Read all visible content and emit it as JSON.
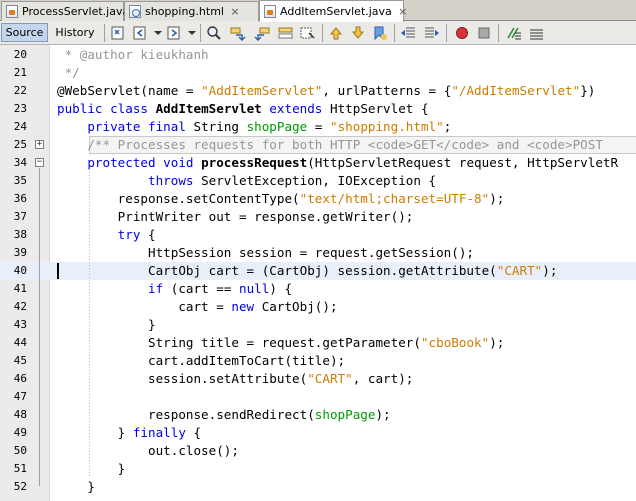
{
  "tabs": [
    {
      "label": "ProcessServlet.java",
      "icon": "java-file-icon",
      "active": false
    },
    {
      "label": "shopping.html",
      "icon": "html-file-icon",
      "active": false
    },
    {
      "label": "AddItemServlet.java",
      "icon": "java-file-icon",
      "active": true
    }
  ],
  "toolbar": {
    "source_label": "Source",
    "history_label": "History"
  },
  "editor": {
    "current_line": "40",
    "lines": [
      {
        "num": "20",
        "tokens": [
          {
            "t": " * @author kieukhanh",
            "c": "cm"
          }
        ]
      },
      {
        "num": "21",
        "tokens": [
          {
            "t": " */",
            "c": "cm"
          }
        ]
      },
      {
        "num": "22",
        "tokens": [
          {
            "t": "@WebServlet",
            "c": "ann"
          },
          {
            "t": "(name = ",
            "c": ""
          },
          {
            "t": "\"AddItemServlet\"",
            "c": "str"
          },
          {
            "t": ", urlPatterns = {",
            "c": ""
          },
          {
            "t": "\"/AddItemServlet\"",
            "c": "str"
          },
          {
            "t": "})",
            "c": ""
          }
        ]
      },
      {
        "num": "23",
        "tokens": [
          {
            "t": "public class ",
            "c": "kw"
          },
          {
            "t": "AddItemServlet",
            "c": "b"
          },
          {
            "t": " extends ",
            "c": "kw"
          },
          {
            "t": "HttpServlet {",
            "c": ""
          }
        ]
      },
      {
        "num": "24",
        "tokens": [
          {
            "t": "    private final ",
            "c": "kw"
          },
          {
            "t": "String ",
            "c": ""
          },
          {
            "t": "shopPage",
            "c": "fld"
          },
          {
            "t": " = ",
            "c": ""
          },
          {
            "t": "\"shopping.html\"",
            "c": "str"
          },
          {
            "t": ";",
            "c": ""
          }
        ]
      },
      {
        "num": "25",
        "tokens": [
          {
            "t": "    /** Processes requests for both HTTP <code>GET</code> and <code>POST",
            "c": "cm"
          }
        ]
      },
      {
        "num": "34",
        "tokens": [
          {
            "t": "    protected void ",
            "c": "kw"
          },
          {
            "t": "processRequest",
            "c": "b"
          },
          {
            "t": "(HttpServletRequest request, HttpServletR",
            "c": ""
          }
        ]
      },
      {
        "num": "35",
        "tokens": [
          {
            "t": "            throws ",
            "c": "kw"
          },
          {
            "t": "ServletException, IOException {",
            "c": ""
          }
        ]
      },
      {
        "num": "36",
        "tokens": [
          {
            "t": "        response.setContentType(",
            "c": ""
          },
          {
            "t": "\"text/html;charset=UTF-8\"",
            "c": "str"
          },
          {
            "t": ");",
            "c": ""
          }
        ]
      },
      {
        "num": "37",
        "tokens": [
          {
            "t": "        PrintWriter out = response.getWriter();",
            "c": ""
          }
        ]
      },
      {
        "num": "38",
        "tokens": [
          {
            "t": "        try",
            "c": "kw"
          },
          {
            "t": " {",
            "c": ""
          }
        ]
      },
      {
        "num": "39",
        "tokens": [
          {
            "t": "            HttpSession session = request.getSession();",
            "c": ""
          }
        ]
      },
      {
        "num": "40",
        "tokens": [
          {
            "t": "            CartObj cart = (CartObj) session.getAttribute(",
            "c": ""
          },
          {
            "t": "\"CART\"",
            "c": "str"
          },
          {
            "t": ");",
            "c": ""
          }
        ]
      },
      {
        "num": "41",
        "tokens": [
          {
            "t": "            if",
            "c": "kw"
          },
          {
            "t": " (cart == ",
            "c": ""
          },
          {
            "t": "null",
            "c": "kw"
          },
          {
            "t": ") {",
            "c": ""
          }
        ]
      },
      {
        "num": "42",
        "tokens": [
          {
            "t": "                cart = ",
            "c": ""
          },
          {
            "t": "new",
            "c": "kw"
          },
          {
            "t": " CartObj();",
            "c": ""
          }
        ]
      },
      {
        "num": "43",
        "tokens": [
          {
            "t": "            }",
            "c": ""
          }
        ]
      },
      {
        "num": "44",
        "tokens": [
          {
            "t": "            String title = request.getParameter(",
            "c": ""
          },
          {
            "t": "\"cboBook\"",
            "c": "str"
          },
          {
            "t": ");",
            "c": ""
          }
        ]
      },
      {
        "num": "45",
        "tokens": [
          {
            "t": "            cart.addItemToCart(title);",
            "c": ""
          }
        ]
      },
      {
        "num": "46",
        "tokens": [
          {
            "t": "            session.setAttribute(",
            "c": ""
          },
          {
            "t": "\"CART\"",
            "c": "str"
          },
          {
            "t": ", cart);",
            "c": ""
          }
        ]
      },
      {
        "num": "47",
        "tokens": []
      },
      {
        "num": "48",
        "tokens": [
          {
            "t": "            response.sendRedirect(",
            "c": ""
          },
          {
            "t": "shopPage",
            "c": "fld"
          },
          {
            "t": ");",
            "c": ""
          }
        ]
      },
      {
        "num": "49",
        "tokens": [
          {
            "t": "        } ",
            "c": ""
          },
          {
            "t": "finally",
            "c": "kw"
          },
          {
            "t": " {",
            "c": ""
          }
        ]
      },
      {
        "num": "50",
        "tokens": [
          {
            "t": "            out.close();",
            "c": ""
          }
        ]
      },
      {
        "num": "51",
        "tokens": [
          {
            "t": "        }",
            "c": ""
          }
        ]
      },
      {
        "num": "52",
        "tokens": [
          {
            "t": "    }",
            "c": ""
          }
        ]
      }
    ]
  },
  "colors": {
    "keyword": "#0000e6",
    "string": "#ce7b00",
    "comment": "#969696",
    "field": "#009900",
    "current_line": "#e9eff8"
  }
}
